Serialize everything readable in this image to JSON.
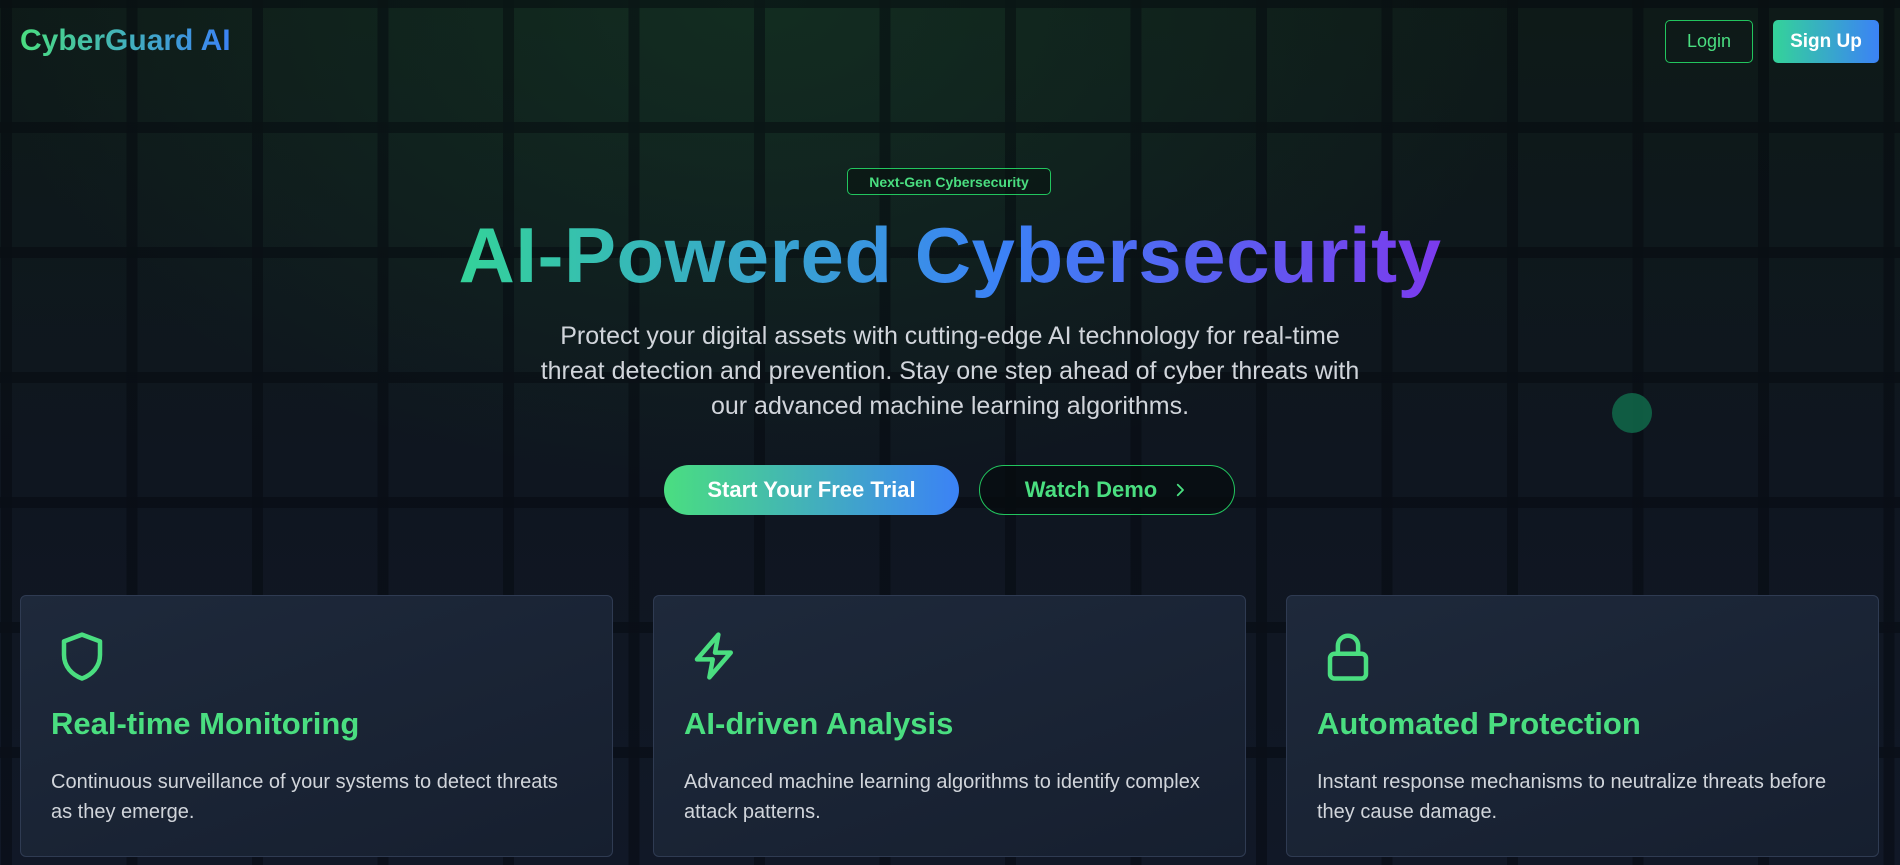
{
  "header": {
    "logo": "CyberGuard AI",
    "login_label": "Login",
    "signup_label": "Sign Up"
  },
  "hero": {
    "badge": "Next-Gen Cybersecurity",
    "title": "AI-Powered Cybersecurity",
    "subtitle": "Protect your digital assets with cutting-edge AI technology for real-time threat detection and prevention. Stay one step ahead of cyber threats with our advanced machine learning algorithms.",
    "cta_primary": "Start Your Free Trial",
    "cta_secondary": "Watch Demo",
    "cta_secondary_icon": "chevron-right-icon"
  },
  "features": [
    {
      "icon": "shield-icon",
      "title": "Real-time Monitoring",
      "description": "Continuous surveillance of your systems to detect threats as they emerge."
    },
    {
      "icon": "lightning-icon",
      "title": "AI-driven Analysis",
      "description": "Advanced machine learning algorithms to identify complex attack patterns."
    },
    {
      "icon": "lock-icon",
      "title": "Automated Protection",
      "description": "Instant response mechanisms to neutralize threats before they cause damage."
    }
  ],
  "colors": {
    "accent_green": "#4ade80",
    "accent_blue": "#3b82f6",
    "accent_purple": "#7c3aed",
    "background": "#0f1421",
    "card_background": "#1e293b"
  }
}
